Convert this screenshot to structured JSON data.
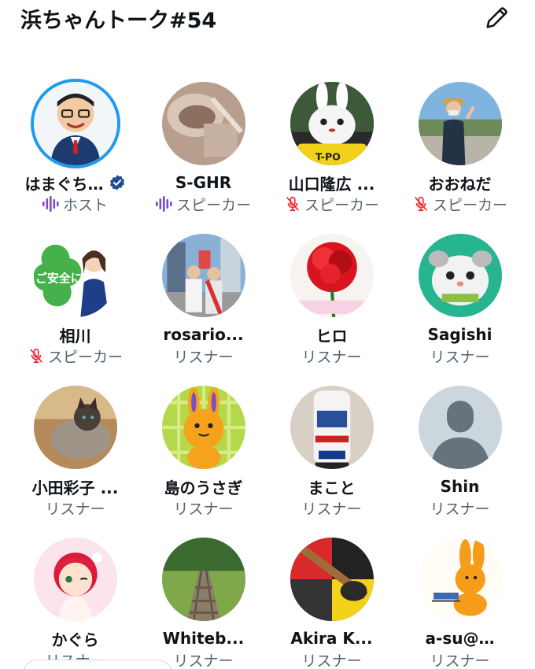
{
  "header": {
    "title": "浜ちゃんトーク#54"
  },
  "icons": {
    "edit": "pencil-icon",
    "verified": "verified-badge-icon",
    "speaking": "audio-waveform-icon",
    "muted": "microphone-muted-icon"
  },
  "colors": {
    "accent": "#1d9bf0",
    "muted_icon": "#f4212e",
    "speaking_icon": "#794bc4",
    "secondary_text": "#536471"
  },
  "participants": [
    {
      "name": "はまぐち…",
      "role": "ホスト",
      "verified": true,
      "role_icon": "speaking",
      "avatar": "caricature-man-glasses"
    },
    {
      "name": "S-GHR",
      "role": "スピーカー",
      "verified": false,
      "role_icon": "speaking",
      "avatar": "sepia-photo"
    },
    {
      "name": "山口隆広 ...",
      "role": "スピーカー",
      "verified": false,
      "role_icon": "muted",
      "avatar": "white-rabbit-mascot"
    },
    {
      "name": "おおねだ",
      "role": "スピーカー",
      "verified": false,
      "role_icon": "muted",
      "avatar": "person-outdoors"
    },
    {
      "name": "相川",
      "role": "スピーカー",
      "verified": false,
      "role_icon": "muted",
      "avatar": "clover-illustration",
      "avatar_text": "ご安全に"
    },
    {
      "name": "rosario...",
      "role": "リスナー",
      "verified": false,
      "role_icon": "none",
      "avatar": "two-people-city"
    },
    {
      "name": "ヒロ",
      "role": "リスナー",
      "verified": false,
      "role_icon": "none",
      "avatar": "red-carnation"
    },
    {
      "name": "Sagishi",
      "role": "リスナー",
      "verified": false,
      "role_icon": "none",
      "avatar": "hamster-cartoon"
    },
    {
      "name": "小田彩子 ...",
      "role": "リスナー",
      "verified": false,
      "role_icon": "none",
      "avatar": "siamese-cat"
    },
    {
      "name": "島のうさぎ",
      "role": "リスナー",
      "verified": false,
      "role_icon": "none",
      "avatar": "orange-bunny-plaid"
    },
    {
      "name": "まこと",
      "role": "リスナー",
      "verified": false,
      "role_icon": "none",
      "avatar": "rally-car-model"
    },
    {
      "name": "Shin",
      "role": "リスナー",
      "verified": false,
      "role_icon": "none",
      "avatar": "default-silhouette"
    },
    {
      "name": "かぐら",
      "role": "リスナー",
      "verified": false,
      "role_icon": "none",
      "avatar": "anime-girl"
    },
    {
      "name": "Whiteb...",
      "role": "リスナー",
      "verified": false,
      "role_icon": "none",
      "avatar": "railway-tracks"
    },
    {
      "name": "Akira K...",
      "role": "リスナー",
      "verified": false,
      "role_icon": "none",
      "avatar": "guitar-colorful"
    },
    {
      "name": "a-su@…",
      "role": "リスナー",
      "verified": false,
      "role_icon": "none",
      "avatar": "orange-rabbit-reading"
    }
  ]
}
